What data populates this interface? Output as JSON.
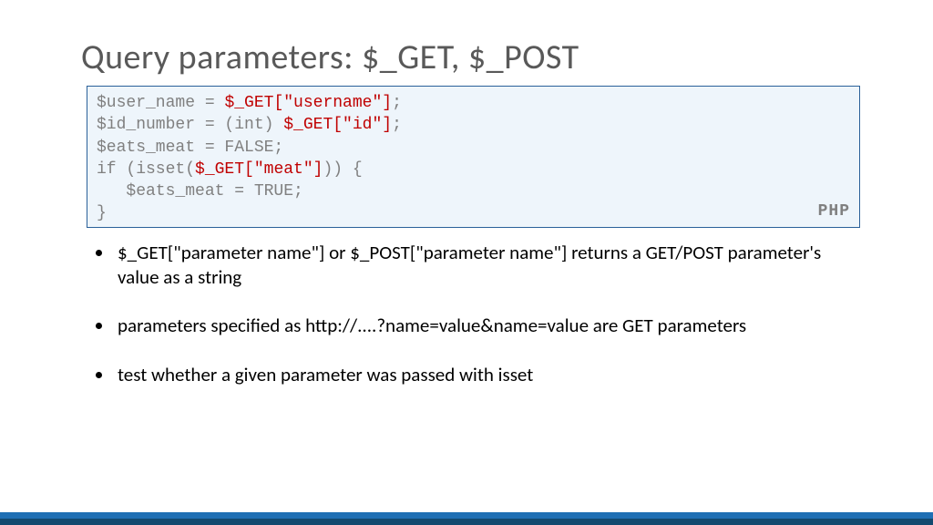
{
  "title": "Query parameters: $_GET, $_POST",
  "code": {
    "l1a": "$user_name = ",
    "l1b": "$_GET[\"username\"]",
    "l1c": ";",
    "l2a": "$id_number = (int) ",
    "l2b": "$_GET[\"id\"]",
    "l2c": ";",
    "l3": "$eats_meat = FALSE;",
    "l4a": "if (isset(",
    "l4b": "$_GET[\"meat\"]",
    "l4c": ")) {",
    "l5": "   $eats_meat = TRUE;",
    "l6": "}",
    "label": "PHP"
  },
  "bullets": [
    "$_GET[\"parameter name\"] or $_POST[\"parameter name\"] returns a GET/POST parameter's value as a string",
    "parameters specified as http://....?name=value&name=value are GET parameters",
    "test whether a given parameter was passed with isset"
  ]
}
